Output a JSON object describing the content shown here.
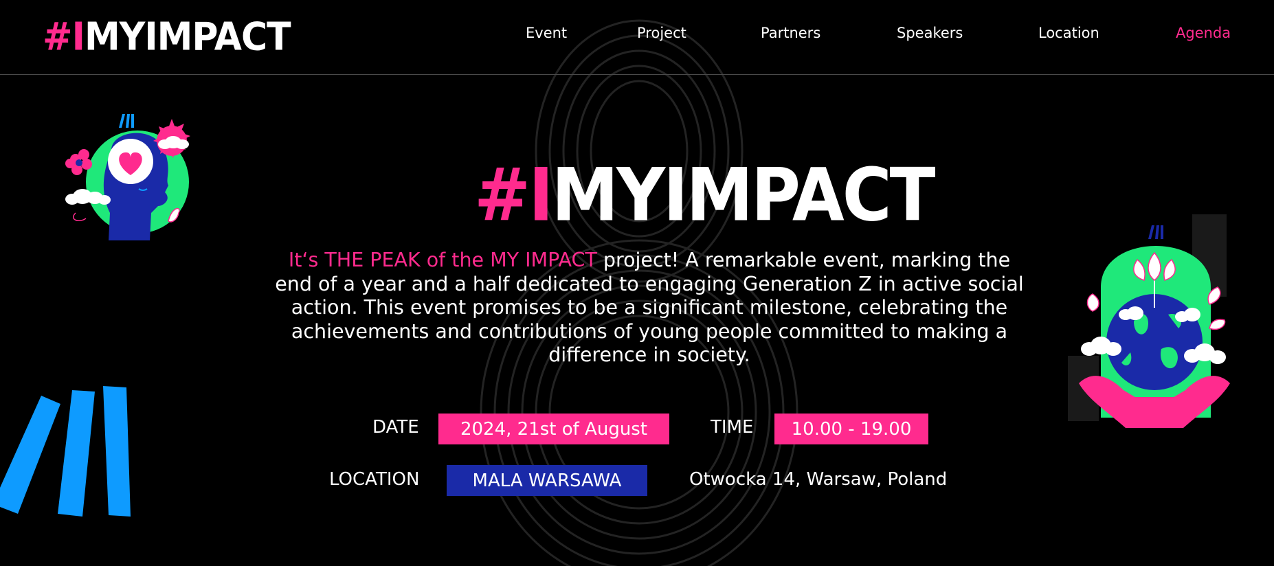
{
  "header": {
    "logo": {
      "hash": "#",
      "i": "I",
      "rest": "MYIMPACT"
    },
    "nav": [
      {
        "label": "Event",
        "active": false
      },
      {
        "label": "Project",
        "active": false
      },
      {
        "label": "Partners",
        "active": false
      },
      {
        "label": "Speakers",
        "active": false
      },
      {
        "label": "Location",
        "active": false
      },
      {
        "label": "Agenda",
        "active": true
      }
    ]
  },
  "hero": {
    "logo": {
      "hash": "#",
      "i": "I",
      "rest": "MYIMPACT"
    },
    "intro_highlight": "It‘s THE PEAK of the MY IMPACT",
    "intro_rest": " project! A remarkable event, marking the end of a year and a half dedicated to engaging Generation Z in active social action. This event promises to be a significant milestone, celebrating the achievements and contributions of young people committed to making a difference in society.",
    "date_label": "DATE",
    "date_value": "2024, 21st of August",
    "time_label": "TIME",
    "time_value": "10.00 - 19.00",
    "location_label": "LOCATION",
    "location_value": "MALA WARSAWA",
    "address": "Otwocka 14, Warsaw, Poland"
  },
  "colors": {
    "background": "#000000",
    "accent_pink": "#ff2b8e",
    "accent_blue": "#1a2aa8",
    "accent_green": "#1fe87a",
    "accent_sky": "#0e9bff",
    "text": "#ffffff"
  },
  "icons": {
    "left_illustration": "head-with-heart-illustration",
    "right_illustration": "earth-in-hands-illustration",
    "slashes": "triple-slash-graphic"
  }
}
